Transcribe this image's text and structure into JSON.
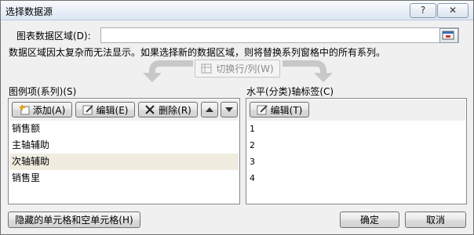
{
  "window": {
    "title": "选择数据源",
    "help_label": "?",
    "close_label": "✕"
  },
  "range": {
    "label": "图表数据区域(D):",
    "value": ""
  },
  "message": "数据区域因太复杂而无法显示。如果选择新的数据区域，则将替换系列窗格中的所有系列。",
  "switch_button": {
    "label": "切换行/列(W)"
  },
  "legend_panel": {
    "label": "图例项(系列)(S)",
    "add_label": "添加(A)",
    "edit_label": "编辑(E)",
    "delete_label": "删除(R)",
    "items": [
      "销售额",
      "主轴辅助",
      "次轴辅助",
      "销售里"
    ],
    "selected_index": 2
  },
  "axis_panel": {
    "label": "水平(分类)轴标签(C)",
    "edit_label": "编辑(T)",
    "items": [
      "1",
      "2",
      "3",
      "4"
    ]
  },
  "footer": {
    "hidden_cells_label": "隐藏的单元格和空单元格(H)",
    "ok_label": "确定",
    "cancel_label": "取消"
  },
  "colors": {
    "selected_row": "#f0ece0",
    "title_gradient_bottom": "#dce7f3"
  }
}
